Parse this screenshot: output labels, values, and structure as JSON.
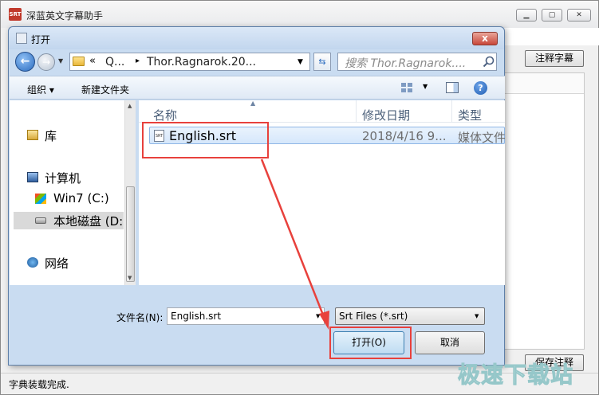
{
  "app": {
    "title": "深蓝英文字幕助手",
    "icon_text": "SRT",
    "buttons": {
      "annotate_subtitle": "注释字幕",
      "save_annotation": "保存注释"
    },
    "status_text": "字典装载完成."
  },
  "dialog": {
    "title": "打开",
    "close_label": "x",
    "address": {
      "chevron": "«",
      "segments": [
        "Q...",
        "Thor.Ragnarok.20..."
      ],
      "separator": "▸"
    },
    "search": {
      "placeholder": "搜索 Thor.Ragnarok...."
    },
    "toolbar": {
      "organize_label": "组织 ▾",
      "new_folder_label": "新建文件夹"
    },
    "nav_pane": {
      "items": [
        {
          "label": "库",
          "icon": "library-icon"
        },
        {
          "label": "计算机",
          "icon": "computer-icon"
        },
        {
          "label": "Win7 (C:)",
          "icon": "windows-drive-icon"
        },
        {
          "label": "本地磁盘 (D:",
          "icon": "local-disk-icon",
          "selected": true
        },
        {
          "label": "网络",
          "icon": "network-icon"
        }
      ]
    },
    "file_list": {
      "columns": [
        "名称",
        "修改日期",
        "类型"
      ],
      "rows": [
        {
          "name": "English.srt",
          "date": "2018/4/16 9...",
          "type": "媒体文件",
          "selected": true
        }
      ]
    },
    "filename_label": "文件名(N):",
    "filename_value": "English.srt",
    "filter_value": "Srt Files (*.srt)",
    "open_button": "打开(O)",
    "cancel_button": "取消"
  },
  "annotation": {
    "color": "#e8413c"
  },
  "watermark": "极速下载站"
}
